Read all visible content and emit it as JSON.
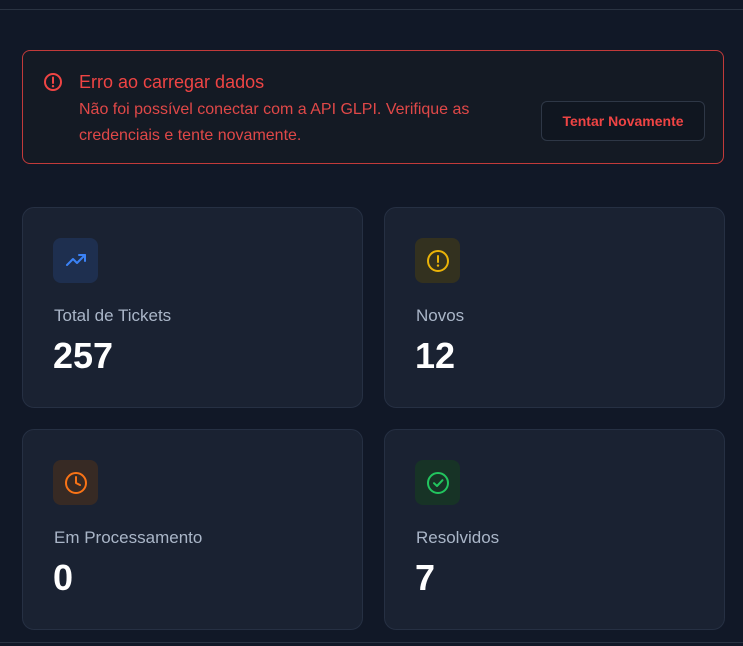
{
  "alert": {
    "title": "Erro ao carregar dados",
    "message": "Não foi possível conectar com a API GLPI. Verifique as credenciais e tente novamente.",
    "retry_label": "Tentar Novamente",
    "color": "#ef4444"
  },
  "stats": [
    {
      "label": "Total de Tickets",
      "value": "257",
      "icon": "trending-up-icon",
      "color": "#3b82f6"
    },
    {
      "label": "Novos",
      "value": "12",
      "icon": "alert-circle-icon",
      "color": "#eab308"
    },
    {
      "label": "Em Processamento",
      "value": "0",
      "icon": "clock-icon",
      "color": "#f97316"
    },
    {
      "label": "Resolvidos",
      "value": "7",
      "icon": "check-circle-icon",
      "color": "#22c55e"
    }
  ]
}
